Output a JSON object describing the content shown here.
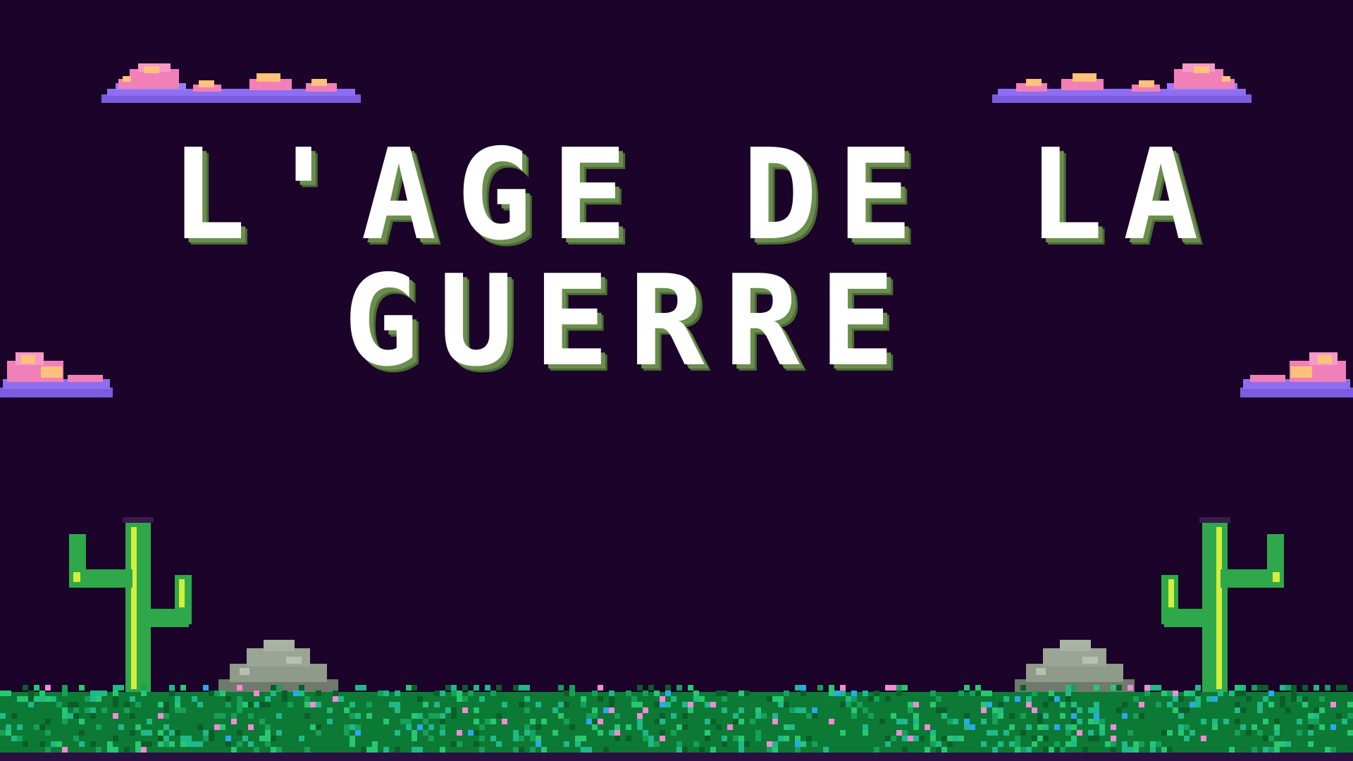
{
  "title": {
    "line1": "L'AGE DE LA",
    "line2": "GUERRE"
  },
  "colors": {
    "background": "#1b0329",
    "title_text": "#ffffff",
    "title_shadow": "#6b8e4e",
    "cloud_base": "#7b5ce0",
    "cloud_pink": "#f280b8",
    "cloud_highlight": "#ffc27a",
    "cactus_green": "#2ea84a",
    "cactus_highlight": "#d4ee3a",
    "rock": "#8e9a8a",
    "grass_dark": "#0c7a34",
    "grass_light": "#1fb98a",
    "flower_pink": "#f28ad8",
    "flower_blue": "#2aa8f0"
  },
  "icons": [
    "cloud-icon",
    "cactus-icon",
    "rock-icon"
  ]
}
